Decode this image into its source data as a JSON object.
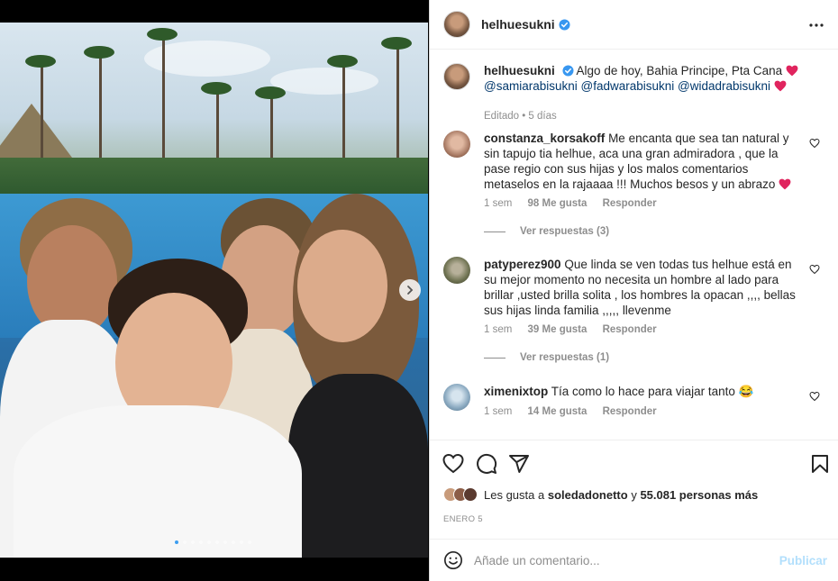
{
  "post": {
    "username": "helhuesukni",
    "verified": true
  },
  "caption": {
    "username": "helhuesukni",
    "text": "Algo de hoy, Bahia Principe, Pta Cana",
    "mentions": [
      "@samiarabisukni",
      "@fadwarabisukni",
      "@widadrabisukni"
    ],
    "meta": "Editado • 5 días"
  },
  "comments": [
    {
      "username": "constanza_korsakoff",
      "text": "Me encanta que sea tan natural y sin tapujo tia helhue, aca una gran admiradora , que la pase regio con sus hijas y los malos comentarios metaselos en la rajaaaa !!! Muchos besos y un abrazo",
      "time": "1 sem",
      "likes": "98 Me gusta",
      "reply": "Responder",
      "view_replies": "Ver respuestas (3)"
    },
    {
      "username": "patyperez900",
      "text": "Que linda se ven todas tus helhue está en su mejor momento no necesita un hombre al lado para brillar ,usted brilla solita , los hombres la opacan ,,,, bellas sus hijas linda familia ,,,,, llevenme",
      "time": "1 sem",
      "likes": "39 Me gusta",
      "reply": "Responder",
      "view_replies": "Ver respuestas (1)"
    },
    {
      "username": "ximenixtop",
      "text": "Tía como lo hace para viajar tanto 😂",
      "time": "1 sem",
      "likes": "14 Me gusta",
      "reply": "Responder"
    }
  ],
  "likes": {
    "prefix": "Les gusta a",
    "user": "soledadonetto",
    "joiner": "y",
    "others": "55.081 personas más"
  },
  "date": "ENERO 5",
  "composer": {
    "placeholder": "Añade un comentario...",
    "publish": "Publicar"
  },
  "carousel": {
    "total_dots": 10,
    "active_index": 0
  },
  "colors": {
    "verified": "#3897f0",
    "heart": "#ed4956",
    "link": "#00376b",
    "muted": "#8e8e8e",
    "publish": "#b2dffc"
  }
}
